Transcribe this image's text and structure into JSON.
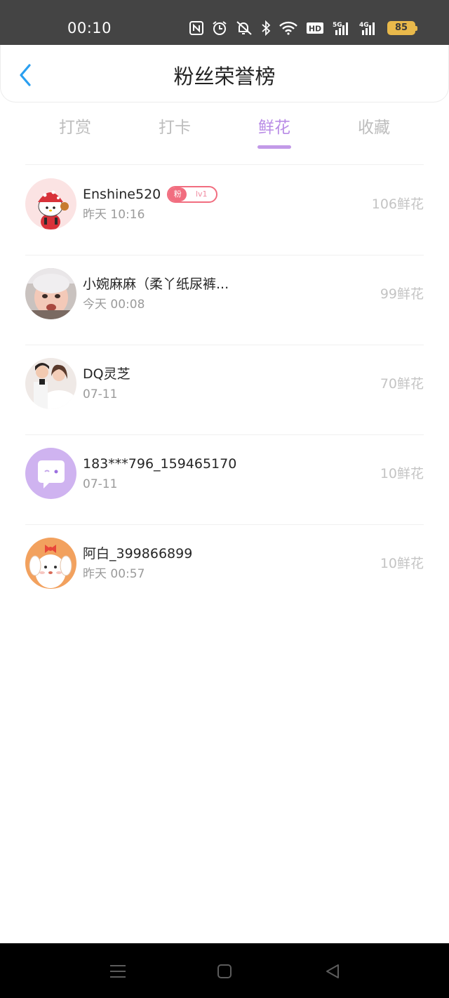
{
  "status_bar": {
    "time": "00:10",
    "icons": [
      "nfc-icon",
      "alarm-icon",
      "mute-icon",
      "bluetooth-icon",
      "wifi-icon",
      "hd-icon",
      "signal-5g-icon",
      "signal-4g-icon",
      "battery-icon"
    ],
    "hd_label": "HD",
    "net_5g": "5G",
    "net_4g": "4G",
    "battery_level": "85",
    "battery_color": "#e9b94b"
  },
  "header": {
    "title": "粉丝荣誉榜",
    "back_icon": "back-chevron-icon"
  },
  "tabs": [
    {
      "label": "打赏",
      "active": false
    },
    {
      "label": "打卡",
      "active": false
    },
    {
      "label": "鲜花",
      "active": true
    },
    {
      "label": "收藏",
      "active": false
    }
  ],
  "accent_color": "#b98ce6",
  "fans": [
    {
      "name": "Enshine520",
      "time": "昨天 10:16",
      "count": "106鲜花",
      "badge": {
        "left": "粉",
        "right": "lv1"
      },
      "avatar": "hello-kitty-avatar"
    },
    {
      "name": "小婉麻麻（柔丫纸尿裤...",
      "time": "今天 00:08",
      "count": "99鲜花",
      "avatar": "baby-photo-avatar"
    },
    {
      "name": "DQ灵芝",
      "time": "07-11",
      "count": "70鲜花",
      "avatar": "wedding-photo-avatar"
    },
    {
      "name": "183***796_159465170",
      "time": "07-11",
      "count": "10鲜花",
      "avatar": "chat-bubble-avatar"
    },
    {
      "name": "阿白_399866899",
      "time": "昨天 00:57",
      "count": "10鲜花",
      "avatar": "cartoon-dog-avatar"
    }
  ],
  "nav_bar": {
    "buttons": [
      "menu-icon",
      "home-icon",
      "back-triangle-icon"
    ]
  }
}
